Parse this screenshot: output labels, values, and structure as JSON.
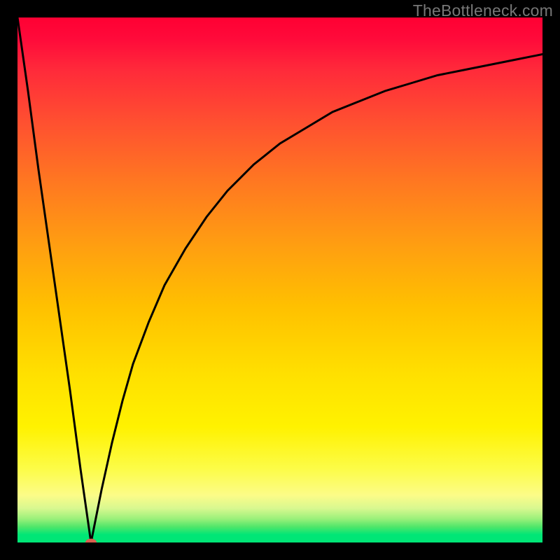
{
  "site": {
    "watermark": "TheBottleneck.com"
  },
  "chart_data": {
    "type": "line",
    "title": "",
    "xlabel": "",
    "ylabel": "",
    "xlim": [
      0,
      100
    ],
    "ylim": [
      0,
      100
    ],
    "grid": false,
    "legend": false,
    "optimal_x": 14,
    "series": [
      {
        "name": "bottleneck-curve",
        "x": [
          0,
          2,
          4,
          6,
          8,
          10,
          12,
          14,
          16,
          18,
          20,
          22,
          25,
          28,
          32,
          36,
          40,
          45,
          50,
          55,
          60,
          65,
          70,
          75,
          80,
          85,
          90,
          95,
          100
        ],
        "y": [
          100,
          86,
          71,
          57,
          43,
          29,
          14,
          0,
          10,
          19,
          27,
          34,
          42,
          49,
          56,
          62,
          67,
          72,
          76,
          79,
          82,
          84,
          86,
          87.5,
          89,
          90,
          91,
          92,
          93
        ]
      }
    ],
    "marker": {
      "x": 14,
      "y": 0
    },
    "background_gradient": {
      "top": "#ff0033",
      "mid_upper": "#ffa010",
      "mid": "#ffe000",
      "mid_lower": "#fcfc88",
      "bottom": "#00e676"
    }
  }
}
